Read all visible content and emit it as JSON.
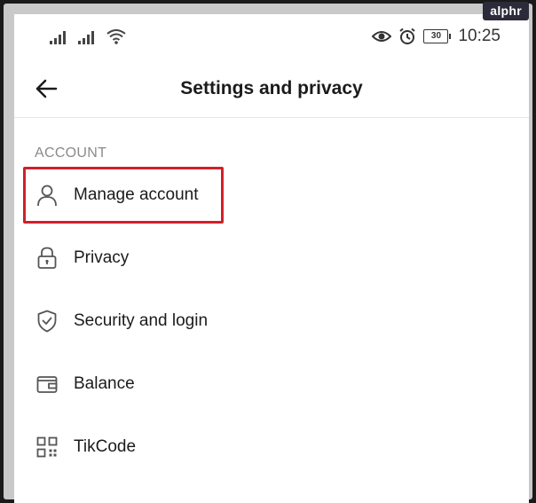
{
  "watermark": "alphr",
  "status_bar": {
    "battery_level": "30",
    "time": "10:25",
    "icons": [
      "signal-icon",
      "signal-icon",
      "wifi-icon",
      "eye-icon",
      "alarm-icon",
      "battery-icon"
    ]
  },
  "header": {
    "title": "Settings and privacy",
    "back_icon": "back-arrow-icon"
  },
  "section": {
    "label": "ACCOUNT"
  },
  "menu": {
    "items": [
      {
        "label": "Manage account",
        "icon": "person-icon",
        "highlighted": true
      },
      {
        "label": "Privacy",
        "icon": "lock-icon"
      },
      {
        "label": "Security and login",
        "icon": "shield-icon"
      },
      {
        "label": "Balance",
        "icon": "wallet-icon"
      },
      {
        "label": "TikCode",
        "icon": "qr-code-icon"
      }
    ]
  },
  "colors": {
    "highlight": "#d0202a",
    "text": "#1b1b1b",
    "section_label": "#8a8a8a"
  }
}
